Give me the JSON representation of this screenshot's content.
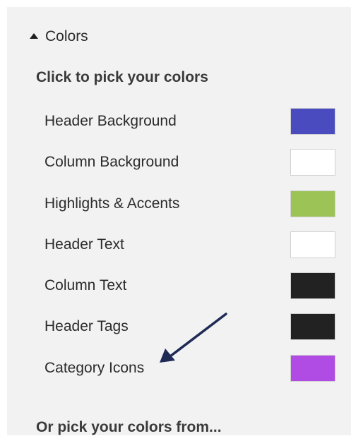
{
  "section": {
    "title": "Colors",
    "icon": "caret-up-icon"
  },
  "subtitle": "Click to pick your colors",
  "colors": [
    {
      "label": "Header Background",
      "value": "#4b4bc0"
    },
    {
      "label": "Column Background",
      "value": "#ffffff"
    },
    {
      "label": "Highlights & Accents",
      "value": "#9cc356"
    },
    {
      "label": "Header Text",
      "value": "#ffffff"
    },
    {
      "label": "Column Text",
      "value": "#222222"
    },
    {
      "label": "Header Tags",
      "value": "#222222"
    },
    {
      "label": "Category Icons",
      "value": "#b04be4"
    }
  ],
  "annotation": {
    "icon": "pointer-arrow-icon",
    "color": "#1f2a55"
  },
  "footer": "Or pick your colors from..."
}
